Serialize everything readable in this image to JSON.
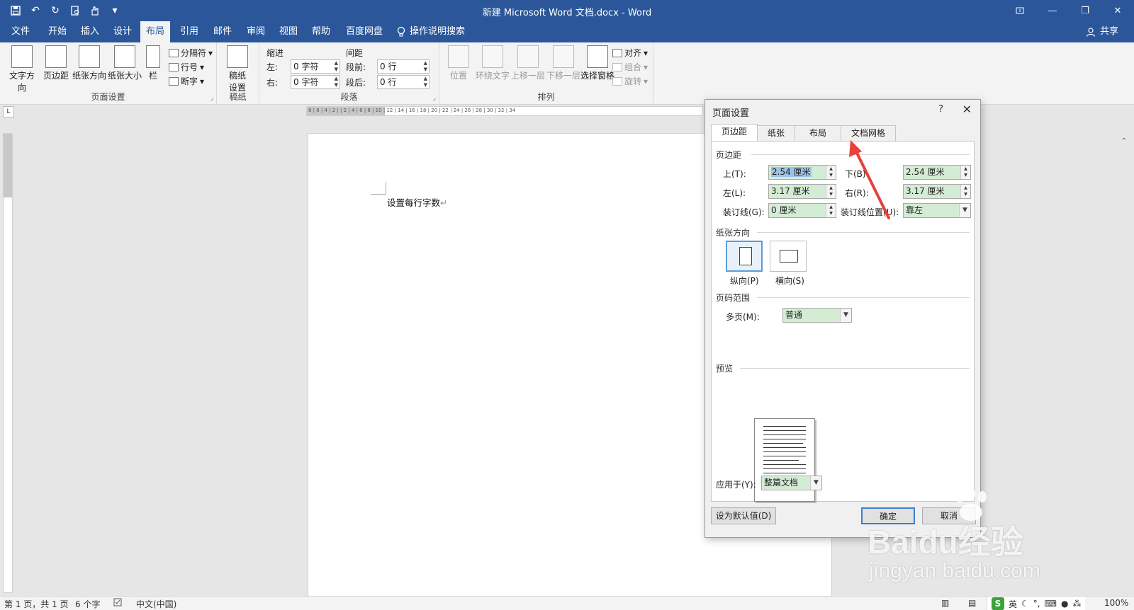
{
  "window": {
    "title": "新建 Microsoft Word 文档.docx  -  Word",
    "minimize": "—",
    "restore": "❐",
    "close": "✕"
  },
  "qat": {
    "save": "💾",
    "undo": "↶",
    "redo": "↻",
    "preview": "🔍",
    "touch": "✋",
    "customize": "▾"
  },
  "menu": {
    "tabs": [
      "文件",
      "开始",
      "插入",
      "设计",
      "布局",
      "引用",
      "邮件",
      "审阅",
      "视图",
      "帮助",
      "百度网盘"
    ],
    "active_index": 4,
    "search": "操作说明搜索",
    "share": "共享"
  },
  "ribbon": {
    "page_setup": {
      "label": "页面设置",
      "text_direction": "文字方向",
      "margins": "页边距",
      "orientation": "纸张方向",
      "size": "纸张大小",
      "columns": "栏",
      "breaks": "分隔符",
      "line_numbers": "行号",
      "hyphenation": "断字"
    },
    "draft": {
      "label": "稿纸",
      "button": "稿纸\n设置",
      "button_line1": "稿纸",
      "button_line2": "设置"
    },
    "paragraph": {
      "label": "段落",
      "indent_header": "缩进",
      "spacing_header": "间距",
      "left_label": "左:",
      "left_value": "0 字符",
      "right_label": "右:",
      "right_value": "0 字符",
      "before_label": "段前:",
      "before_value": "0 行",
      "after_label": "段后:",
      "after_value": "0 行"
    },
    "arrange": {
      "label": "排列",
      "position": "位置",
      "wrap": "环绕文字",
      "forward": "上移一层",
      "backward": "下移一层",
      "selection_pane": "选择窗格",
      "align": "对齐",
      "group": "组合",
      "rotate": "旋转"
    }
  },
  "document": {
    "text": "设置每行字数",
    "para_mark": "↵"
  },
  "ruler": {
    "ticks": "8 | 6 | 4 | 2 |   | 2 | 4 | 6 | 8 | 10 | 12 | 14 | 16 | 18 | 20 | 22 | 24 | 26 | 28 | 30 | 32 | 34"
  },
  "status": {
    "page": "第 1 页，共 1 页",
    "words": "6 个字",
    "language": "中文(中国)",
    "zoom": "100%",
    "ime_lang": "英"
  },
  "dialog": {
    "title": "页面设置",
    "help": "?",
    "close": "✕",
    "tabs": [
      "页边距",
      "纸张",
      "布局",
      "文档网格"
    ],
    "active_tab": 0,
    "margins_section": "页边距",
    "top_label": "上(T):",
    "top_value": "2.54 厘米",
    "bottom_label": "下(B):",
    "bottom_value": "2.54 厘米",
    "left_label": "左(L):",
    "left_value": "3.17 厘米",
    "right_label": "右(R):",
    "right_value": "3.17 厘米",
    "gutter_label": "装订线(G):",
    "gutter_value": "0 厘米",
    "gutter_pos_label": "装订线位置(U):",
    "gutter_pos_value": "靠左",
    "orientation_section": "纸张方向",
    "portrait": "纵向(P)",
    "landscape": "横向(S)",
    "pages_section": "页码范围",
    "multiple_label": "多页(M):",
    "multiple_value": "普通",
    "preview_section": "预览",
    "apply_label": "应用于(Y):",
    "apply_value": "整篇文档",
    "default_button": "设为默认值(D)",
    "ok_button": "确定",
    "cancel_button": "取消"
  },
  "watermark": {
    "brand": "Baidu经验",
    "url": "jingyan.baidu.com"
  },
  "colors": {
    "accent": "#2b579a",
    "field_bg": "#d4ecd4",
    "arrow": "#e8403c",
    "focus": "#3c7fd0"
  }
}
